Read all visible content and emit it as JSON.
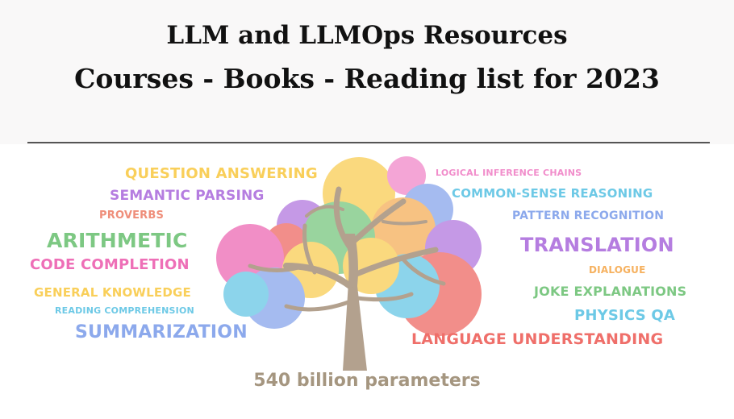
{
  "header": {
    "line1": "LLM  and LLMOps Resources",
    "line2": "Courses - Books - Reading list for 2023"
  },
  "tree": {
    "caption": "540 billion parameters",
    "capabilities": [
      {
        "label": "QUESTION ANSWERING",
        "color": "#f9cf5a"
      },
      {
        "label": "SEMANTIC PARSING",
        "color": "#b57de0"
      },
      {
        "label": "PROVERBS",
        "color": "#ef8e7a"
      },
      {
        "label": "ARITHMETIC",
        "color": "#7dc883"
      },
      {
        "label": "CODE COMPLETION",
        "color": "#ee6fb7"
      },
      {
        "label": "GENERAL KNOWLEDGE",
        "color": "#f9cf5a"
      },
      {
        "label": "READING COMPREHENSION",
        "color": "#6dc9e6"
      },
      {
        "label": "SUMMARIZATION",
        "color": "#8ca9ec"
      },
      {
        "label": "LOGICAL INFERENCE CHAINS",
        "color": "#f18dcb"
      },
      {
        "label": "COMMON-SENSE REASONING",
        "color": "#6dc9e6"
      },
      {
        "label": "PATTERN RECOGNITION",
        "color": "#8ca9ec"
      },
      {
        "label": "TRANSLATION",
        "color": "#b57de0"
      },
      {
        "label": "DIALOGUE",
        "color": "#f6b15f"
      },
      {
        "label": "JOKE EXPLANATIONS",
        "color": "#7dc883"
      },
      {
        "label": "PHYSICS QA",
        "color": "#6dc9e6"
      },
      {
        "label": "LANGUAGE UNDERSTANDING",
        "color": "#ef6f6a"
      }
    ]
  }
}
